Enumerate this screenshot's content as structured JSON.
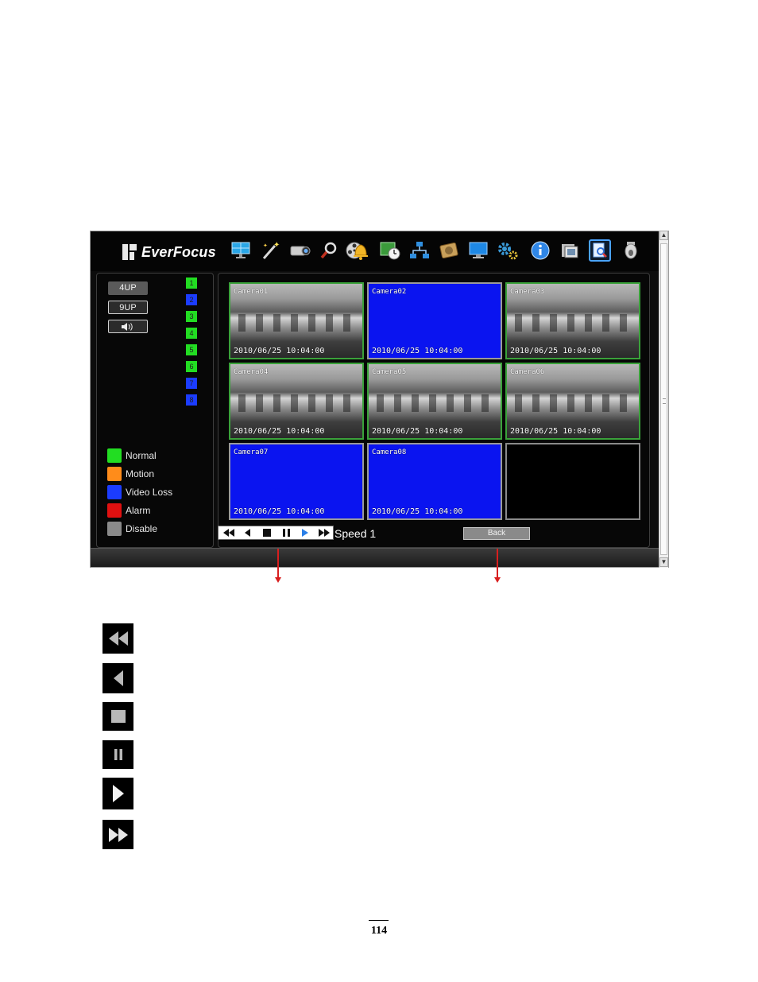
{
  "app": {
    "logo_text": "EverFocus",
    "toolbar": {
      "icons": [
        "display-icon",
        "wand-icon",
        "camera-icon",
        "search-magnifier-icon",
        "film-reel-icon",
        "alarm-bell-icon",
        "schedule-clock-icon",
        "network-icon",
        "disk-icon",
        "monitor-icon",
        "gear-icon",
        "info-icon",
        "film-strip-icon",
        "playback-search-icon",
        "dome-camera-icon"
      ],
      "selected": "playback-search-icon"
    },
    "left_panel": {
      "buttons": [
        "4UP",
        "9UP"
      ],
      "audio_icon": "speaker-icon",
      "channels": [
        {
          "label": "1",
          "color": "#22dd22"
        },
        {
          "label": "2",
          "color": "#1b3cff"
        },
        {
          "label": "3",
          "color": "#22dd22"
        },
        {
          "label": "4",
          "color": "#22dd22"
        },
        {
          "label": "5",
          "color": "#22dd22"
        },
        {
          "label": "6",
          "color": "#22dd22"
        },
        {
          "label": "7",
          "color": "#1b3cff"
        },
        {
          "label": "8",
          "color": "#1b3cff"
        }
      ],
      "legend": [
        {
          "label": "Normal",
          "color": "#22dd22"
        },
        {
          "label": "Motion",
          "color": "#ff8c1a"
        },
        {
          "label": "Video Loss",
          "color": "#1b3cff"
        },
        {
          "label": "Alarm",
          "color": "#e01010"
        },
        {
          "label": "Disable",
          "color": "#8a8a8a"
        }
      ]
    },
    "cameras": [
      {
        "name": "Camera01",
        "timestamp": "2010/06/25 10:04:00",
        "state": "cam"
      },
      {
        "name": "Camera02",
        "timestamp": "2010/06/25 10:04:00",
        "state": "loss"
      },
      {
        "name": "Camera03",
        "timestamp": "2010/06/25 10:04:00",
        "state": "cam"
      },
      {
        "name": "Camera04",
        "timestamp": "2010/06/25 10:04:00",
        "state": "cam"
      },
      {
        "name": "Camera05",
        "timestamp": "2010/06/25 10:04:00",
        "state": "cam"
      },
      {
        "name": "Camera06",
        "timestamp": "2010/06/25 10:04:00",
        "state": "cam"
      },
      {
        "name": "Camera07",
        "timestamp": "2010/06/25 10:04:00",
        "state": "loss"
      },
      {
        "name": "Camera08",
        "timestamp": "2010/06/25 10:04:00",
        "state": "loss"
      },
      {
        "name": "",
        "timestamp": "",
        "state": "empty"
      }
    ],
    "playback": {
      "controls": [
        "fast-rewind-icon",
        "reverse-play-icon",
        "stop-icon",
        "pause-icon",
        "play-icon",
        "fast-forward-icon"
      ],
      "speed_label": "Speed 1",
      "back_label": "Back"
    }
  },
  "control_icons": [
    "fast-rewind-icon",
    "reverse-play-icon",
    "stop-icon",
    "pause-icon",
    "play-icon",
    "fast-forward-icon"
  ],
  "page_number": "114"
}
